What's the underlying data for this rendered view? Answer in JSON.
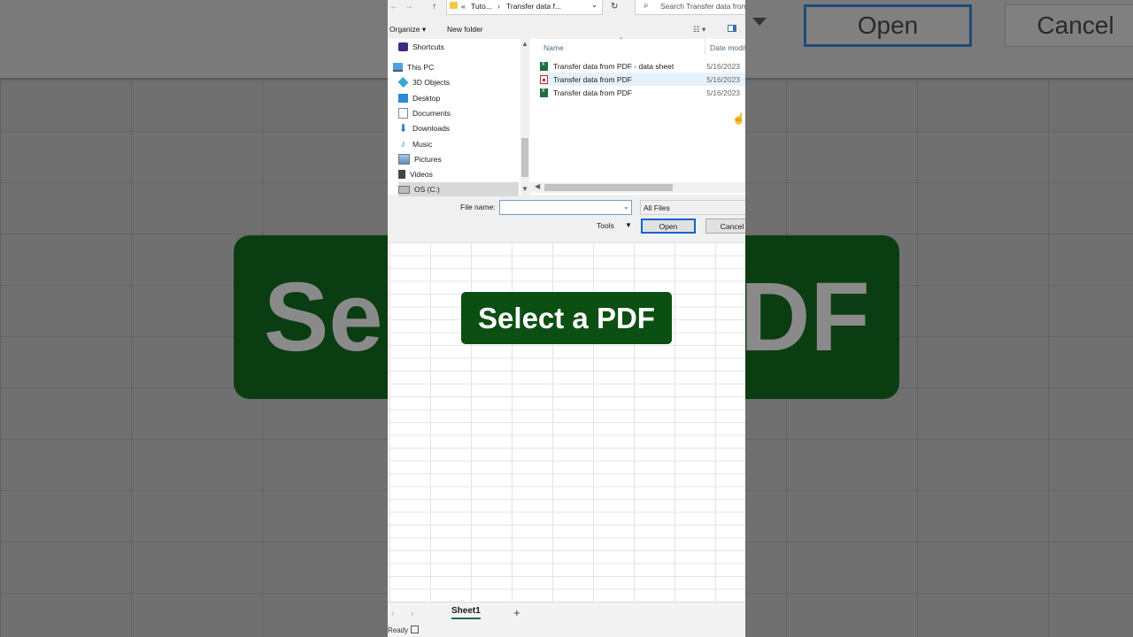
{
  "dialog": {
    "address": {
      "prefix": "«",
      "crumb1": "Tuto...",
      "sep": "›",
      "crumb2": "Transfer data f...",
      "dropdown": "⌄",
      "refresh": "↻"
    },
    "search_placeholder": "Search Transfer data from PDF",
    "toolbar": {
      "organize": "Organize ▾",
      "new_folder": "New folder"
    },
    "tree": [
      {
        "label": "Shortcuts"
      },
      {
        "label": "This PC"
      },
      {
        "label": "3D Objects"
      },
      {
        "label": "Desktop"
      },
      {
        "label": "Documents"
      },
      {
        "label": "Downloads"
      },
      {
        "label": "Music"
      },
      {
        "label": "Pictures"
      },
      {
        "label": "Videos"
      },
      {
        "label": "OS (C:)"
      }
    ],
    "columns": {
      "name": "Name",
      "date": "Date modified"
    },
    "files": [
      {
        "name": "Transfer data from PDF - data sheet",
        "date": "5/16/2023",
        "type": "excel"
      },
      {
        "name": "Transfer data from PDF",
        "date": "5/16/2023",
        "type": "pdf"
      },
      {
        "name": "Transfer data from PDF",
        "date": "5/16/2023",
        "type": "excel"
      }
    ],
    "file_name_label": "File name:",
    "file_name_value": "",
    "filter": "All Files",
    "tools": "Tools",
    "open": "Open",
    "cancel": "Cancel"
  },
  "background": {
    "open": "Open",
    "cancel": "Cancel",
    "banner_left": "Se",
    "banner_right": "DF"
  },
  "banner": "Select a PDF",
  "sheet": {
    "tab": "Sheet1",
    "add": "+",
    "status": "Ready"
  }
}
